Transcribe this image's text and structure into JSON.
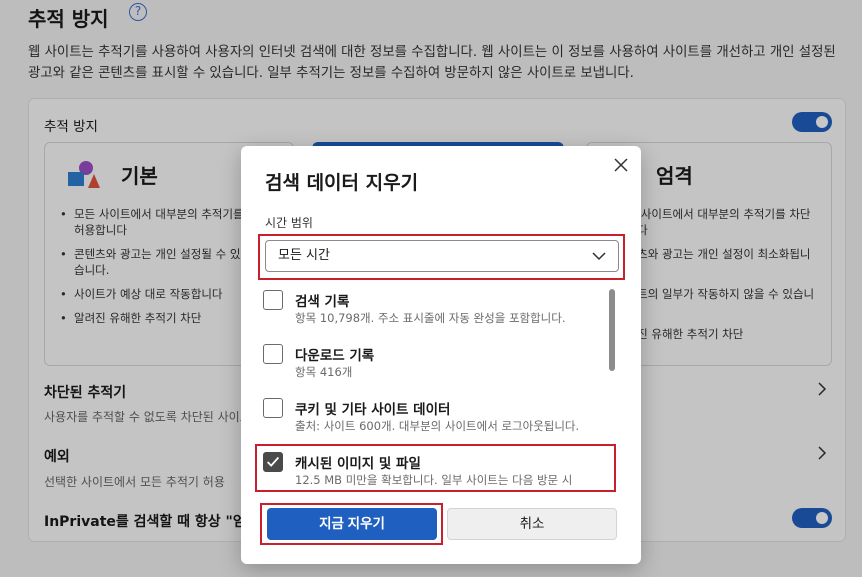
{
  "page": {
    "title": "추적 방지",
    "help_icon": "help-icon",
    "description": "웹 사이트는 추적기를 사용하여 사용자의 인터넷 검색에 대한 정보를 수집합니다. 웹 사이트는 이 정보를 사용하여 사이트를 개선하고 개인 설정된 광고와 같은 콘텐츠를 표시할 수 있습니다. 일부 추적기는 정보를 수집하여 방문하지 않은 사이트로 보냅니다.",
    "panel_label": "추적 방지"
  },
  "cards": {
    "basic": {
      "title": "기본",
      "items": [
        "모든 사이트에서 대부분의 추적기를 허용합니다",
        "콘텐츠와 광고는 개인 설정될 수 있습니다.",
        "사이트가 예상 대로 작동합니다",
        "알려진 유해한 추적기 차단"
      ]
    },
    "strict": {
      "title": "엄격",
      "items": [
        "모든 사이트에서 대부분의 추적기를 차단합니다",
        "콘텐츠와 광고는 개인 설정이 최소화됩니다.",
        "사이트의 일부가 작동하지 않을 수 있습니다",
        "알려진 유해한 추적기 차단"
      ]
    }
  },
  "rows": {
    "blocked": {
      "title": "차단된 추적기",
      "sub": "사용자를 추적할 수 없도록 차단된 사이트를 확인합니다"
    },
    "exceptions": {
      "title": "예외",
      "sub": "선택한 사이트에서 모든 추적기 허용"
    },
    "inprivate": {
      "title": "InPrivate를 검색할 때 항상 \"엄격\" 추적 방지 사용"
    }
  },
  "dialog": {
    "title": "검색 데이터 지우기",
    "range_label": "시간 범위",
    "range_value": "모든 시간",
    "options": [
      {
        "title": "검색 기록",
        "sub": "항목 10,798개. 주소 표시줄에 자동 완성을 포함합니다.",
        "checked": false
      },
      {
        "title": "다운로드 기록",
        "sub": "항목 416개",
        "checked": false
      },
      {
        "title": "쿠키 및 기타 사이트 데이터",
        "sub": "출처: 사이트 600개. 대부분의 사이트에서 로그아웃됩니다.",
        "checked": false
      },
      {
        "title": "캐시된 이미지 및 파일",
        "sub": "12.5 MB 미만을 확보합니다. 일부 사이트는 다음 방문 시",
        "checked": true
      }
    ],
    "clear_button": "지금 지우기",
    "cancel_button": "취소"
  },
  "colors": {
    "accent": "#1f5fc0",
    "highlight": "#c8202f"
  }
}
